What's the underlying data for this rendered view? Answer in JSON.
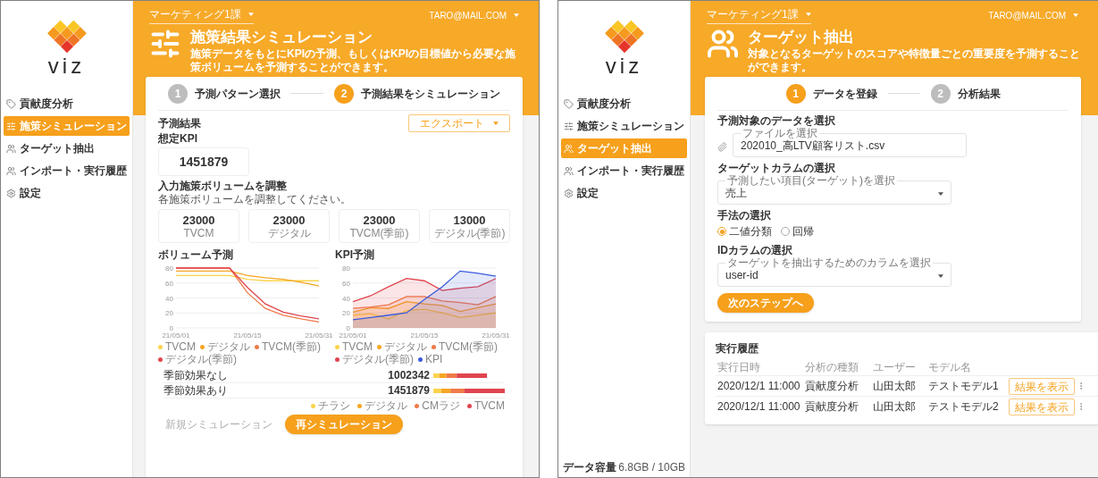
{
  "simulation": {
    "sidebar": {
      "logo": "viz",
      "items": [
        {
          "label": "貢献度分析",
          "selected": false
        },
        {
          "label": "施策シミュレーション",
          "selected": true
        },
        {
          "label": "ターゲット抽出",
          "selected": false
        },
        {
          "label": "インポート・実行履歴",
          "selected": false
        },
        {
          "label": "設定",
          "selected": false
        }
      ]
    },
    "header": {
      "team": "マーケティング1課",
      "user": "TARO@MAIL.COM",
      "title": "施策結果シミュレーション",
      "subtitle": "施策データをもとにKPIの予測、もしくはKPIの目標値から必要な施策ボリュームを予測することができます。"
    },
    "steps": [
      {
        "number": "1",
        "label": "予測パターン選択",
        "current": false
      },
      {
        "number": "2",
        "label": "予測結果をシミュレーション",
        "current": true
      }
    ],
    "result": {
      "title": "予測結果",
      "export_button": "エクスポート",
      "kpi_label": "想定KPI",
      "kpi_value": "1451879"
    },
    "volumes": {
      "title": "入力施策ボリュームを調整",
      "hint": "各施策ボリュームを調整してください。",
      "items": [
        {
          "value": "23000",
          "label": "TVCM"
        },
        {
          "value": "23000",
          "label": "デジタル"
        },
        {
          "value": "23000",
          "label": "TVCM(季節)"
        },
        {
          "value": "13000",
          "label": "デジタル(季節)"
        }
      ]
    },
    "charts": [
      {
        "chart_data": {
          "type": "line",
          "title": "ボリューム予測",
          "grid": true,
          "categories": [
            "21/05/01",
            null,
            null,
            null,
            "21/05/15",
            null,
            null,
            null,
            "21/05/31"
          ],
          "ylim": [
            0,
            80
          ],
          "yticks": [
            0,
            20,
            40,
            60,
            80
          ],
          "series": [
            {
              "name": "TVCM",
              "color": "#fcd34d",
              "values": [
                70,
                70,
                70,
                70,
                65,
                63,
                63,
                63,
                63
              ]
            },
            {
              "name": "デジタル",
              "color": "#f5a623",
              "values": [
                76,
                76,
                76,
                76,
                70,
                67,
                65,
                61,
                56
              ]
            },
            {
              "name": "TVCM(季節)",
              "color": "#f07a4a",
              "values": [
                80,
                80,
                80,
                80,
                47,
                26,
                17,
                12,
                8
              ]
            },
            {
              "name": "デジタル(季節)",
              "color": "#e0454f",
              "values": [
                80,
                80,
                80,
                80,
                54,
                32,
                21,
                16,
                12
              ]
            }
          ]
        }
      },
      {
        "chart_data": {
          "type": "area",
          "title": "KPI予測",
          "grid": true,
          "categories": [
            "21/05/01",
            null,
            null,
            null,
            "21/05/15",
            null,
            null,
            null,
            "21/05/31"
          ],
          "ylim": [
            0,
            80
          ],
          "yticks": [
            0,
            20,
            40,
            60,
            80
          ],
          "series": [
            {
              "name": "TVCM",
              "color": "#fcd34d",
              "values": [
                17,
                19,
                12,
                23,
                25,
                20,
                14,
                17,
                20
              ]
            },
            {
              "name": "デジタル",
              "color": "#f5a623",
              "values": [
                21,
                27,
                26,
                35,
                32,
                30,
                22,
                27,
                32
              ]
            },
            {
              "name": "TVCM(季節)",
              "color": "#f07a4a",
              "values": [
                26,
                28,
                31,
                42,
                42,
                36,
                34,
                31,
                42
              ]
            },
            {
              "name": "デジタル(季節)",
              "color": "#e0454f",
              "values": [
                35,
                43,
                55,
                66,
                63,
                50,
                53,
                55,
                66
              ]
            },
            {
              "name": "KPI",
              "color": "#3b5bdb",
              "values": [
                11,
                14,
                17,
                20,
                38,
                55,
                76,
                73,
                69
              ]
            }
          ]
        }
      }
    ],
    "comparison": {
      "rows": [
        {
          "label": "季節効果なし",
          "value": "1002342"
        },
        {
          "label": "季節効果あり",
          "value": "1451879"
        }
      ],
      "legend": [
        {
          "label": "チラシ",
          "color": "#fcd34d"
        },
        {
          "label": "デジタル",
          "color": "#f5a623"
        },
        {
          "label": "CMラジ",
          "color": "#f07a4a"
        },
        {
          "label": "TVCM",
          "color": "#e0454f"
        }
      ]
    },
    "actions": [
      {
        "label": "新規シミュレーション",
        "disabled": true
      },
      {
        "label": "再シミュレーション",
        "disabled": false
      }
    ]
  },
  "target": {
    "sidebar": {
      "logo": "viz",
      "items": [
        {
          "label": "貢献度分析",
          "selected": false
        },
        {
          "label": "施策シミュレーション",
          "selected": false
        },
        {
          "label": "ターゲット抽出",
          "selected": true
        },
        {
          "label": "インポート・実行履歴",
          "selected": false
        },
        {
          "label": "設定",
          "selected": false
        }
      ],
      "storage_label": "データ容量",
      "storage_value": "6.8GB / 10GB"
    },
    "header": {
      "team": "マーケティング1課",
      "user": "TARO@MAIL.COM",
      "title": "ターゲット抽出",
      "subtitle": "対象となるターゲットのスコアや特徴量ごとの重要度を予測することができます。"
    },
    "steps": [
      {
        "number": "1",
        "label": "データを登録",
        "current": true
      },
      {
        "number": "2",
        "label": "分析結果",
        "current": false
      }
    ],
    "form": {
      "sections": [
        {
          "kind": "file",
          "title": "予測対象のデータを選択",
          "field_label": "ファイルを選択",
          "value": "202010_高LTV顧客リスト.csv"
        },
        {
          "kind": "select",
          "title": "ターゲットカラムの選択",
          "field_label": "予測したい項目(ターゲット)を選択",
          "value": "売上"
        },
        {
          "kind": "radio",
          "title": "手法の選択",
          "options": [
            {
              "label": "二値分類",
              "selected": true
            },
            {
              "label": "回帰",
              "selected": false
            }
          ]
        },
        {
          "kind": "select",
          "title": "IDカラムの選択",
          "field_label": "ターゲットを抽出するためのカラムを選択",
          "value": "user-id"
        }
      ],
      "next_button": "次のステップへ"
    },
    "history": {
      "title": "実行履歴",
      "columns": [
        "実行日時",
        "分析の種類",
        "ユーザー",
        "モデル名"
      ],
      "rows": [
        {
          "cells": [
            "2020/12/1 11:000",
            "貢献度分析",
            "山田太郎",
            "テストモデル1"
          ],
          "action": "結果を表示"
        },
        {
          "cells": [
            "2020/12/1 11:000",
            "貢献度分析",
            "山田太郎",
            "テストモデル2"
          ],
          "action": "結果を表示"
        }
      ]
    }
  }
}
